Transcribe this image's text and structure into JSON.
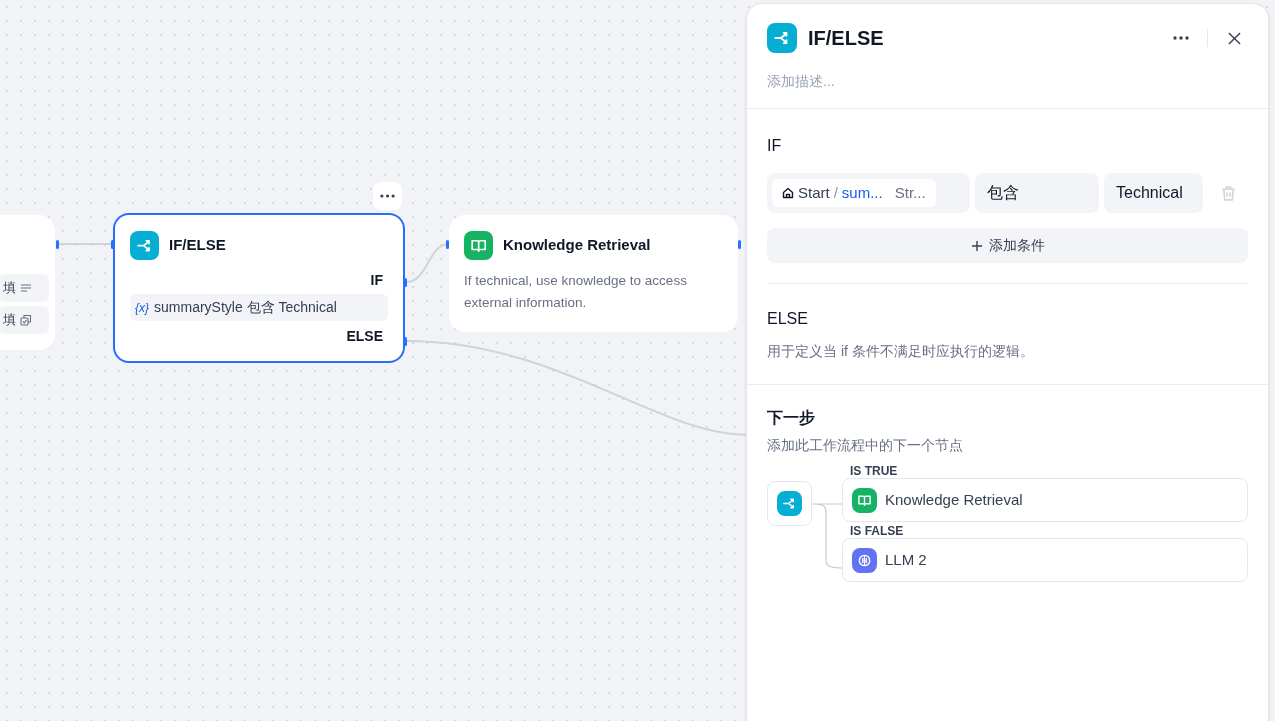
{
  "canvas": {
    "nodes": [
      {
        "kind": "partial",
        "selected": false,
        "rows": [
          {
            "text": "填",
            "kind": "text"
          },
          {
            "text": "填",
            "kind": "file"
          }
        ]
      },
      {
        "kind": "ifelse",
        "selected": true,
        "title": "IF/ELSE",
        "if_label": "IF",
        "condition": {
          "var_mark": "{x}",
          "text": "summaryStyle 包含 Technical"
        },
        "else_label": "ELSE"
      },
      {
        "kind": "knowledge",
        "selected": false,
        "title": "Knowledge Retrieval",
        "description": "If technical, use knowledge to access external information."
      }
    ]
  },
  "panel": {
    "title": "IF/ELSE",
    "description_placeholder": "添加描述...",
    "if_section": {
      "label": "IF",
      "condition": {
        "source": "Start",
        "separator": "/",
        "variable": "sum...",
        "type": "Str...",
        "operator": "包含",
        "value": "Technical"
      },
      "add_button": "添加条件"
    },
    "else_section": {
      "label": "ELSE",
      "description": "用于定义当 if 条件不满足时应执行的逻辑。"
    },
    "next_step": {
      "title": "下一步",
      "description": "添加此工作流程中的下一个节点",
      "branches": [
        {
          "label": "IS TRUE",
          "node": "Knowledge Retrieval",
          "kind": "knowledge"
        },
        {
          "label": "IS FALSE",
          "node": "LLM 2",
          "kind": "llm"
        }
      ]
    }
  }
}
